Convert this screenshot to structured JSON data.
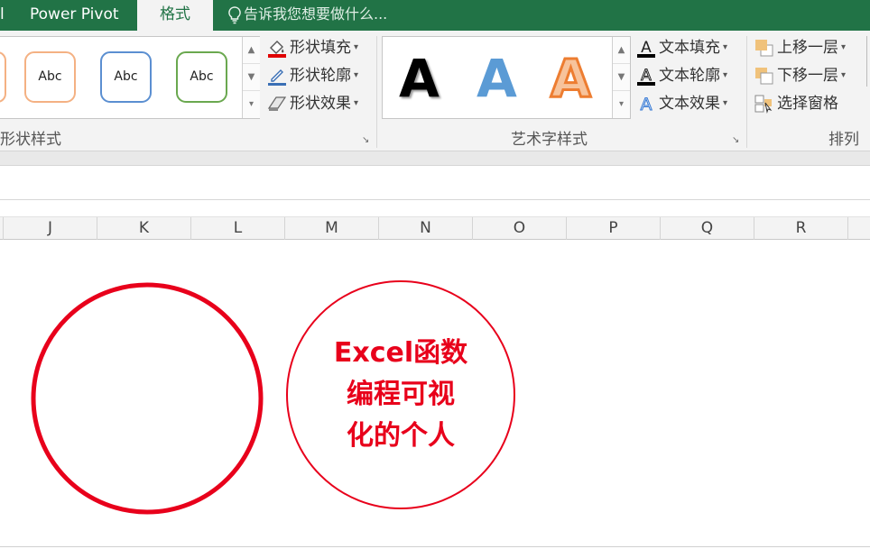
{
  "tabs": {
    "partial_left": "l",
    "power_pivot": "Power Pivot",
    "format": "格式",
    "tell_me": "告诉我您想要做什么..."
  },
  "shape_styles": {
    "samples": [
      "Abc",
      "Abc",
      "Abc"
    ],
    "sample_colors": [
      "#f4b183",
      "#5b8fd1",
      "#6aa84f"
    ],
    "fill": "形状填充",
    "outline": "形状轮廓",
    "effects": "形状效果",
    "group_label": "形状样式"
  },
  "wordart": {
    "letters": [
      "A",
      "A",
      "A"
    ],
    "letter_colors": [
      "#000000",
      "#5b9bd5",
      "#ed7d31"
    ],
    "text_fill": "文本填充",
    "text_outline": "文本轮廓",
    "text_effects": "文本效果",
    "group_label": "艺术字样式"
  },
  "arrange": {
    "bring_forward": "上移一层",
    "send_backward": "下移一层",
    "selection_pane": "选择窗格",
    "group_label": "排列"
  },
  "columns": [
    "J",
    "K",
    "L",
    "M",
    "N",
    "O",
    "P",
    "Q",
    "R"
  ],
  "sheet": {
    "circle_text_lines": [
      "Excel函数",
      "编程可视",
      "化的个人"
    ],
    "accent_red": "#e8001b"
  },
  "colors": {
    "excel_green": "#217346"
  }
}
